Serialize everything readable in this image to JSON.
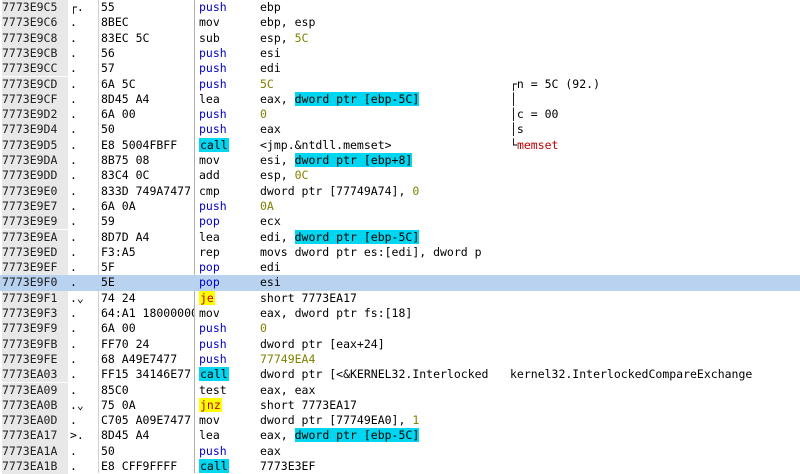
{
  "rows": [
    {
      "addr": "7773E9C5",
      "gut": "┌.",
      "hex": "55",
      "mn": "push",
      "mt": "push",
      "op": [
        {
          "t": "ebp"
        }
      ],
      "cm": []
    },
    {
      "addr": "7773E9C6",
      "gut": ".",
      "hex": "8BEC",
      "mn": "mov",
      "mt": "plain",
      "op": [
        {
          "t": "ebp, esp"
        }
      ],
      "cm": []
    },
    {
      "addr": "7773E9C8",
      "gut": ".",
      "hex": "83EC 5C",
      "mn": "sub",
      "mt": "plain",
      "op": [
        {
          "t": "esp, "
        },
        {
          "t": "5C",
          "c": "num"
        }
      ],
      "cm": []
    },
    {
      "addr": "7773E9CB",
      "gut": ".",
      "hex": "56",
      "mn": "push",
      "mt": "push",
      "op": [
        {
          "t": "esi"
        }
      ],
      "cm": []
    },
    {
      "addr": "7773E9CC",
      "gut": ".",
      "hex": "57",
      "mn": "push",
      "mt": "push",
      "op": [
        {
          "t": "edi"
        }
      ],
      "cm": []
    },
    {
      "addr": "7773E9CD",
      "gut": ".",
      "hex": "6A 5C",
      "mn": "push",
      "mt": "push",
      "op": [
        {
          "t": "5C",
          "c": "num"
        }
      ],
      "cm": [
        {
          "t": "┌n = 5C (92.)",
          "c": "cm-plain"
        }
      ]
    },
    {
      "addr": "7773E9CF",
      "gut": ".",
      "hex": "8D45 A4",
      "mn": "lea",
      "mt": "plain",
      "op": [
        {
          "t": "eax, "
        },
        {
          "t": "dword ptr [ebp-5C]",
          "c": "hl-mem"
        }
      ],
      "cm": [
        {
          "t": "│",
          "c": "cm-plain"
        }
      ]
    },
    {
      "addr": "7773E9D2",
      "gut": ".",
      "hex": "6A 00",
      "mn": "push",
      "mt": "push",
      "op": [
        {
          "t": "0",
          "c": "num"
        }
      ],
      "cm": [
        {
          "t": "│c = 00",
          "c": "cm-plain"
        }
      ]
    },
    {
      "addr": "7773E9D4",
      "gut": ".",
      "hex": "50",
      "mn": "push",
      "mt": "push",
      "op": [
        {
          "t": "eax"
        }
      ],
      "cm": [
        {
          "t": "│s",
          "c": "cm-plain"
        }
      ]
    },
    {
      "addr": "7773E9D5",
      "gut": ".",
      "hex": "E8 5004FBFF",
      "mn": "call",
      "mt": "call",
      "op": [
        {
          "t": "<jmp.&ntdll.memset>"
        }
      ],
      "cm": [
        {
          "t": "└",
          "c": "cm-plain"
        },
        {
          "t": "memset",
          "c": "cm-red"
        }
      ]
    },
    {
      "addr": "7773E9DA",
      "gut": ".",
      "hex": "8B75 08",
      "mn": "mov",
      "mt": "plain",
      "op": [
        {
          "t": "esi, "
        },
        {
          "t": "dword ptr [ebp+8]",
          "c": "hl-mem"
        }
      ],
      "cm": []
    },
    {
      "addr": "7773E9DD",
      "gut": ".",
      "hex": "83C4 0C",
      "mn": "add",
      "mt": "plain",
      "op": [
        {
          "t": "esp, "
        },
        {
          "t": "0C",
          "c": "num"
        }
      ],
      "cm": []
    },
    {
      "addr": "7773E9E0",
      "gut": ".",
      "hex": "833D 749A7477",
      "mn": "cmp",
      "mt": "plain",
      "op": [
        {
          "t": "dword ptr [77749A74], "
        },
        {
          "t": "0",
          "c": "num"
        }
      ],
      "cm": []
    },
    {
      "addr": "7773E9E7",
      "gut": ".",
      "hex": "6A 0A",
      "mn": "push",
      "mt": "push",
      "op": [
        {
          "t": "0A",
          "c": "num"
        }
      ],
      "cm": []
    },
    {
      "addr": "7773E9E9",
      "gut": ".",
      "hex": "59",
      "mn": "pop",
      "mt": "push",
      "op": [
        {
          "t": "ecx"
        }
      ],
      "cm": []
    },
    {
      "addr": "7773E9EA",
      "gut": ".",
      "hex": "8D7D A4",
      "mn": "lea",
      "mt": "plain",
      "op": [
        {
          "t": "edi, "
        },
        {
          "t": "dword ptr [ebp-5C]",
          "c": "hl-mem"
        }
      ],
      "cm": []
    },
    {
      "addr": "7773E9ED",
      "gut": ".",
      "hex": "F3:A5",
      "mn": "rep",
      "mt": "plain",
      "op": [
        {
          "t": "movs dword ptr es:[edi], dword p"
        }
      ],
      "cm": []
    },
    {
      "addr": "7773E9EF",
      "gut": ".",
      "hex": "5F",
      "mn": "pop",
      "mt": "push",
      "op": [
        {
          "t": "edi"
        }
      ],
      "cm": []
    },
    {
      "addr": "7773E9F0",
      "gut": ".",
      "hex": "5E",
      "mn": "pop",
      "mt": "push",
      "op": [
        {
          "t": "esi"
        }
      ],
      "cm": [],
      "sel": true
    },
    {
      "addr": "7773E9F1",
      "gut": ".⌄",
      "hex": "74 24",
      "mn": "je",
      "mt": "jump",
      "op": [
        {
          "t": "short 7773EA17"
        }
      ],
      "cm": []
    },
    {
      "addr": "7773E9F3",
      "gut": ".",
      "hex": "64:A1 18000000",
      "mn": "mov",
      "mt": "plain",
      "op": [
        {
          "t": "eax, dword ptr fs:[18]"
        }
      ],
      "cm": []
    },
    {
      "addr": "7773E9F9",
      "gut": ".",
      "hex": "6A 00",
      "mn": "push",
      "mt": "push",
      "op": [
        {
          "t": "0",
          "c": "num"
        }
      ],
      "cm": []
    },
    {
      "addr": "7773E9FB",
      "gut": ".",
      "hex": "FF70 24",
      "mn": "push",
      "mt": "push",
      "op": [
        {
          "t": "dword ptr [eax+24]"
        }
      ],
      "cm": []
    },
    {
      "addr": "7773E9FE",
      "gut": ".",
      "hex": "68 A49E7477",
      "mn": "push",
      "mt": "push",
      "op": [
        {
          "t": "77749EA4",
          "c": "num"
        }
      ],
      "cm": []
    },
    {
      "addr": "7773EA03",
      "gut": ".",
      "hex": "FF15 34146E77",
      "mn": "call",
      "mt": "call",
      "op": [
        {
          "t": "dword ptr [<&KERNEL32.Interlocked"
        }
      ],
      "cm": [
        {
          "t": "kernel32.InterlockedCompareExchange",
          "c": "cm-plain"
        }
      ]
    },
    {
      "addr": "7773EA09",
      "gut": ".",
      "hex": "85C0",
      "mn": "test",
      "mt": "plain",
      "op": [
        {
          "t": "eax, eax"
        }
      ],
      "cm": []
    },
    {
      "addr": "7773EA0B",
      "gut": ".⌄",
      "hex": "75 0A",
      "mn": "jnz",
      "mt": "jump",
      "op": [
        {
          "t": "short 7773EA17"
        }
      ],
      "cm": []
    },
    {
      "addr": "7773EA0D",
      "gut": ".",
      "hex": "C705 A09E7477",
      "mn": "mov",
      "mt": "plain",
      "op": [
        {
          "t": "dword ptr [77749EA0], "
        },
        {
          "t": "1",
          "c": "num"
        }
      ],
      "cm": []
    },
    {
      "addr": "7773EA17",
      "gut": ">.",
      "hex": "8D45 A4",
      "mn": "lea",
      "mt": "plain",
      "op": [
        {
          "t": "eax, "
        },
        {
          "t": "dword ptr [ebp-5C]",
          "c": "hl-mem"
        }
      ],
      "cm": []
    },
    {
      "addr": "7773EA1A",
      "gut": ".",
      "hex": "50",
      "mn": "push",
      "mt": "push",
      "op": [
        {
          "t": "eax"
        }
      ],
      "cm": []
    },
    {
      "addr": "7773EA1B",
      "gut": ".",
      "hex": "E8 CFF9FFFF",
      "mn": "call",
      "mt": "call",
      "op": [
        {
          "t": "7773E3EF"
        }
      ],
      "cm": []
    }
  ]
}
